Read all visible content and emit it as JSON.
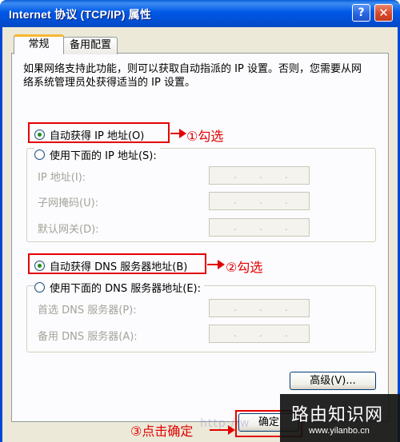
{
  "window": {
    "title": "Internet 协议 (TCP/IP) 属性",
    "help_glyph": "?",
    "close_glyph": "✕"
  },
  "tabs": [
    {
      "label": "常规",
      "active": true
    },
    {
      "label": "备用配置",
      "active": false
    }
  ],
  "description": "如果网络支持此功能，则可以获取自动指派的 IP 设置。否则，您需要从网络系统管理员处获得适当的 IP 设置。",
  "ip_section": {
    "auto_label": "自动获得 IP 地址(O)",
    "manual_label": "使用下面的 IP 地址(S):",
    "auto_checked": true,
    "fields": [
      {
        "label": "IP 地址(I):",
        "value": ".   .   ."
      },
      {
        "label": "子网掩码(U):",
        "value": ".   .   ."
      },
      {
        "label": "默认网关(D):",
        "value": ".   .   ."
      }
    ]
  },
  "dns_section": {
    "auto_label": "自动获得 DNS 服务器地址(B)",
    "manual_label": "使用下面的 DNS 服务器地址(E):",
    "auto_checked": true,
    "fields": [
      {
        "label": "首选 DNS 服务器(P):",
        "value": ".   .   ."
      },
      {
        "label": "备用 DNS 服务器(A):",
        "value": ".   .   ."
      }
    ]
  },
  "buttons": {
    "advanced": "高级(V)...",
    "ok": "确定"
  },
  "annotations": {
    "step1": "①勾选",
    "step2": "②勾选",
    "step3": "③点击确定"
  },
  "watermark": {
    "site_name": "路由知识网",
    "url": "www.yilanbo.cn",
    "faint_url": "http://w"
  },
  "colors": {
    "annotation_red": "#e30000",
    "title_blue": "#0058e6"
  }
}
